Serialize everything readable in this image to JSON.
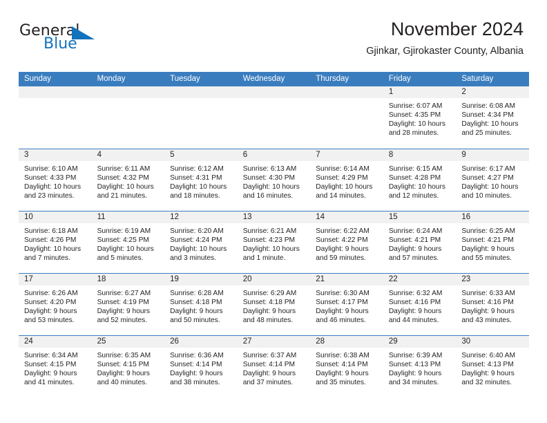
{
  "brand": {
    "name_part1": "General",
    "name_part2": "Blue",
    "accent_color": "#1273bd",
    "triangle_icon": "triangle-icon"
  },
  "header": {
    "title": "November 2024",
    "subtitle": "Gjinkar, Gjirokaster County, Albania"
  },
  "calendar": {
    "header_bg": "#3A7DBF",
    "daynum_bg": "#f1f1f1",
    "weekdays": [
      "Sunday",
      "Monday",
      "Tuesday",
      "Wednesday",
      "Thursday",
      "Friday",
      "Saturday"
    ],
    "weeks": [
      [
        {
          "day": "",
          "empty": true
        },
        {
          "day": "",
          "empty": true
        },
        {
          "day": "",
          "empty": true
        },
        {
          "day": "",
          "empty": true
        },
        {
          "day": "",
          "empty": true
        },
        {
          "day": "1",
          "sunrise": "Sunrise: 6:07 AM",
          "sunset": "Sunset: 4:35 PM",
          "daylight1": "Daylight: 10 hours",
          "daylight2": "and 28 minutes."
        },
        {
          "day": "2",
          "sunrise": "Sunrise: 6:08 AM",
          "sunset": "Sunset: 4:34 PM",
          "daylight1": "Daylight: 10 hours",
          "daylight2": "and 25 minutes."
        }
      ],
      [
        {
          "day": "3",
          "sunrise": "Sunrise: 6:10 AM",
          "sunset": "Sunset: 4:33 PM",
          "daylight1": "Daylight: 10 hours",
          "daylight2": "and 23 minutes."
        },
        {
          "day": "4",
          "sunrise": "Sunrise: 6:11 AM",
          "sunset": "Sunset: 4:32 PM",
          "daylight1": "Daylight: 10 hours",
          "daylight2": "and 21 minutes."
        },
        {
          "day": "5",
          "sunrise": "Sunrise: 6:12 AM",
          "sunset": "Sunset: 4:31 PM",
          "daylight1": "Daylight: 10 hours",
          "daylight2": "and 18 minutes."
        },
        {
          "day": "6",
          "sunrise": "Sunrise: 6:13 AM",
          "sunset": "Sunset: 4:30 PM",
          "daylight1": "Daylight: 10 hours",
          "daylight2": "and 16 minutes."
        },
        {
          "day": "7",
          "sunrise": "Sunrise: 6:14 AM",
          "sunset": "Sunset: 4:29 PM",
          "daylight1": "Daylight: 10 hours",
          "daylight2": "and 14 minutes."
        },
        {
          "day": "8",
          "sunrise": "Sunrise: 6:15 AM",
          "sunset": "Sunset: 4:28 PM",
          "daylight1": "Daylight: 10 hours",
          "daylight2": "and 12 minutes."
        },
        {
          "day": "9",
          "sunrise": "Sunrise: 6:17 AM",
          "sunset": "Sunset: 4:27 PM",
          "daylight1": "Daylight: 10 hours",
          "daylight2": "and 10 minutes."
        }
      ],
      [
        {
          "day": "10",
          "sunrise": "Sunrise: 6:18 AM",
          "sunset": "Sunset: 4:26 PM",
          "daylight1": "Daylight: 10 hours",
          "daylight2": "and 7 minutes."
        },
        {
          "day": "11",
          "sunrise": "Sunrise: 6:19 AM",
          "sunset": "Sunset: 4:25 PM",
          "daylight1": "Daylight: 10 hours",
          "daylight2": "and 5 minutes."
        },
        {
          "day": "12",
          "sunrise": "Sunrise: 6:20 AM",
          "sunset": "Sunset: 4:24 PM",
          "daylight1": "Daylight: 10 hours",
          "daylight2": "and 3 minutes."
        },
        {
          "day": "13",
          "sunrise": "Sunrise: 6:21 AM",
          "sunset": "Sunset: 4:23 PM",
          "daylight1": "Daylight: 10 hours",
          "daylight2": "and 1 minute."
        },
        {
          "day": "14",
          "sunrise": "Sunrise: 6:22 AM",
          "sunset": "Sunset: 4:22 PM",
          "daylight1": "Daylight: 9 hours",
          "daylight2": "and 59 minutes."
        },
        {
          "day": "15",
          "sunrise": "Sunrise: 6:24 AM",
          "sunset": "Sunset: 4:21 PM",
          "daylight1": "Daylight: 9 hours",
          "daylight2": "and 57 minutes."
        },
        {
          "day": "16",
          "sunrise": "Sunrise: 6:25 AM",
          "sunset": "Sunset: 4:21 PM",
          "daylight1": "Daylight: 9 hours",
          "daylight2": "and 55 minutes."
        }
      ],
      [
        {
          "day": "17",
          "sunrise": "Sunrise: 6:26 AM",
          "sunset": "Sunset: 4:20 PM",
          "daylight1": "Daylight: 9 hours",
          "daylight2": "and 53 minutes."
        },
        {
          "day": "18",
          "sunrise": "Sunrise: 6:27 AM",
          "sunset": "Sunset: 4:19 PM",
          "daylight1": "Daylight: 9 hours",
          "daylight2": "and 52 minutes."
        },
        {
          "day": "19",
          "sunrise": "Sunrise: 6:28 AM",
          "sunset": "Sunset: 4:18 PM",
          "daylight1": "Daylight: 9 hours",
          "daylight2": "and 50 minutes."
        },
        {
          "day": "20",
          "sunrise": "Sunrise: 6:29 AM",
          "sunset": "Sunset: 4:18 PM",
          "daylight1": "Daylight: 9 hours",
          "daylight2": "and 48 minutes."
        },
        {
          "day": "21",
          "sunrise": "Sunrise: 6:30 AM",
          "sunset": "Sunset: 4:17 PM",
          "daylight1": "Daylight: 9 hours",
          "daylight2": "and 46 minutes."
        },
        {
          "day": "22",
          "sunrise": "Sunrise: 6:32 AM",
          "sunset": "Sunset: 4:16 PM",
          "daylight1": "Daylight: 9 hours",
          "daylight2": "and 44 minutes."
        },
        {
          "day": "23",
          "sunrise": "Sunrise: 6:33 AM",
          "sunset": "Sunset: 4:16 PM",
          "daylight1": "Daylight: 9 hours",
          "daylight2": "and 43 minutes."
        }
      ],
      [
        {
          "day": "24",
          "sunrise": "Sunrise: 6:34 AM",
          "sunset": "Sunset: 4:15 PM",
          "daylight1": "Daylight: 9 hours",
          "daylight2": "and 41 minutes."
        },
        {
          "day": "25",
          "sunrise": "Sunrise: 6:35 AM",
          "sunset": "Sunset: 4:15 PM",
          "daylight1": "Daylight: 9 hours",
          "daylight2": "and 40 minutes."
        },
        {
          "day": "26",
          "sunrise": "Sunrise: 6:36 AM",
          "sunset": "Sunset: 4:14 PM",
          "daylight1": "Daylight: 9 hours",
          "daylight2": "and 38 minutes."
        },
        {
          "day": "27",
          "sunrise": "Sunrise: 6:37 AM",
          "sunset": "Sunset: 4:14 PM",
          "daylight1": "Daylight: 9 hours",
          "daylight2": "and 37 minutes."
        },
        {
          "day": "28",
          "sunrise": "Sunrise: 6:38 AM",
          "sunset": "Sunset: 4:14 PM",
          "daylight1": "Daylight: 9 hours",
          "daylight2": "and 35 minutes."
        },
        {
          "day": "29",
          "sunrise": "Sunrise: 6:39 AM",
          "sunset": "Sunset: 4:13 PM",
          "daylight1": "Daylight: 9 hours",
          "daylight2": "and 34 minutes."
        },
        {
          "day": "30",
          "sunrise": "Sunrise: 6:40 AM",
          "sunset": "Sunset: 4:13 PM",
          "daylight1": "Daylight: 9 hours",
          "daylight2": "and 32 minutes."
        }
      ]
    ]
  }
}
